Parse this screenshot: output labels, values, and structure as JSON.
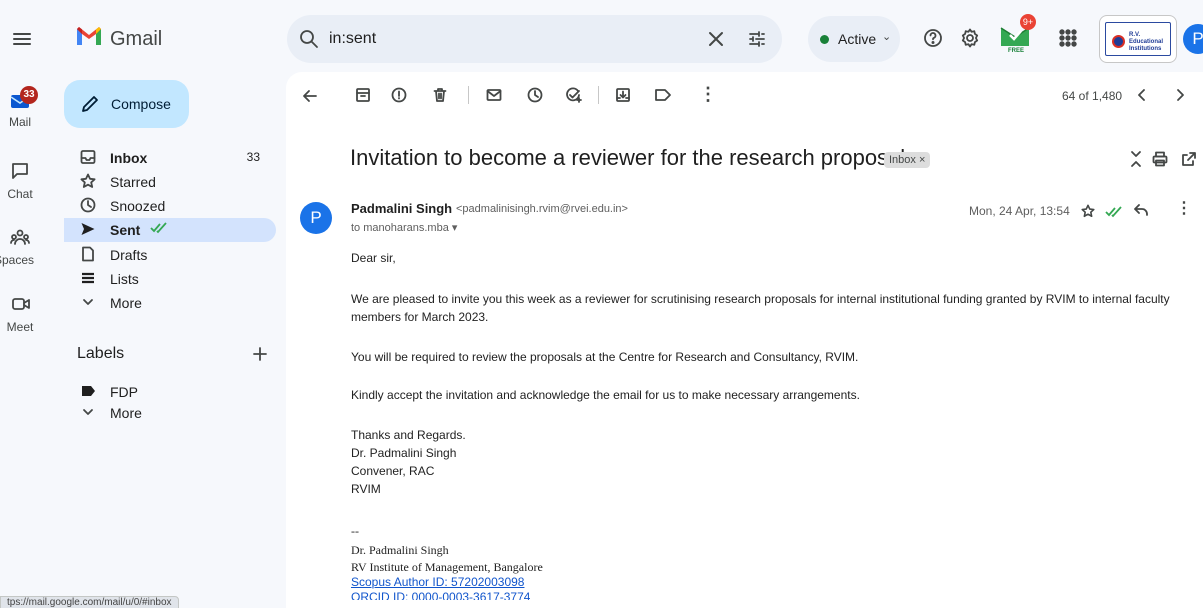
{
  "app": {
    "name": "Gmail"
  },
  "search": {
    "query": "in:sent"
  },
  "status": {
    "label": "Active",
    "apps_badge": "9+",
    "apps_badge_sub": "FREE",
    "profile_initial": "P",
    "org_logo_text": "R.V. Educational Institutions"
  },
  "rail": {
    "mail": {
      "label": "Mail",
      "badge": "33"
    },
    "chat": {
      "label": "Chat"
    },
    "spaces": {
      "label": "Spaces"
    },
    "meet": {
      "label": "Meet"
    }
  },
  "compose": {
    "label": "Compose"
  },
  "nav": {
    "items": [
      {
        "label": "Inbox",
        "count": "33",
        "icon": "inbox-icon"
      },
      {
        "label": "Starred",
        "count": "",
        "icon": "star-icon"
      },
      {
        "label": "Snoozed",
        "count": "",
        "icon": "clock-icon"
      },
      {
        "label": "Sent",
        "count": "",
        "icon": "send-icon"
      },
      {
        "label": "Drafts",
        "count": "",
        "icon": "draft-icon"
      },
      {
        "label": "Lists",
        "count": "",
        "icon": "list-icon"
      },
      {
        "label": "More",
        "count": "",
        "icon": "chevron-down-icon"
      }
    ],
    "labels_heading": "Labels",
    "labels": [
      {
        "label": "FDP"
      },
      {
        "label": "More"
      }
    ]
  },
  "toolbar": {
    "pagination": "64 of 1,480"
  },
  "email": {
    "subject": "Invitation to become a reviewer for the research proposals",
    "tag": "Inbox ×",
    "sender_initial": "P",
    "sender_name": "Padmalini Singh",
    "sender_email": "<padmalinisingh.rvim@rvei.edu.in>",
    "to": "to manoharans.mba ▾",
    "date": "Mon, 24 Apr, 13:54",
    "greeting": "Dear sir,",
    "para1": "We are pleased to invite you this week as a reviewer for scrutinising research proposals for internal institutional funding granted by RVIM to internal faculty members for March 2023.",
    "para2": "You will be required to review the proposals at the Centre for Research and Consultancy, RVIM.",
    "para3": "Kindly accept the invitation and acknowledge the email for us to make necessary arrangements.",
    "closing": [
      "Thanks and Regards.",
      "Dr. Padmalini Singh",
      "Convener, RAC",
      "RVIM"
    ],
    "sig_sep": "--",
    "sig_name": "Dr. Padmalini Singh",
    "sig_org": "RV Institute of Management, Bangalore",
    "sig_scopus": "Scopus Author ID: 57202003098",
    "sig_orcid": "ORCID ID: 0000-0003-3617-3774"
  },
  "statusbar": {
    "url": "tps://mail.google.com/mail/u/0/#inbox"
  },
  "colors": {
    "accent": "#0b57d0",
    "compose": "#c2e7ff",
    "active_nav": "#d3e3fd",
    "gmail_red": "#ea4335",
    "active_green": "#188038"
  }
}
